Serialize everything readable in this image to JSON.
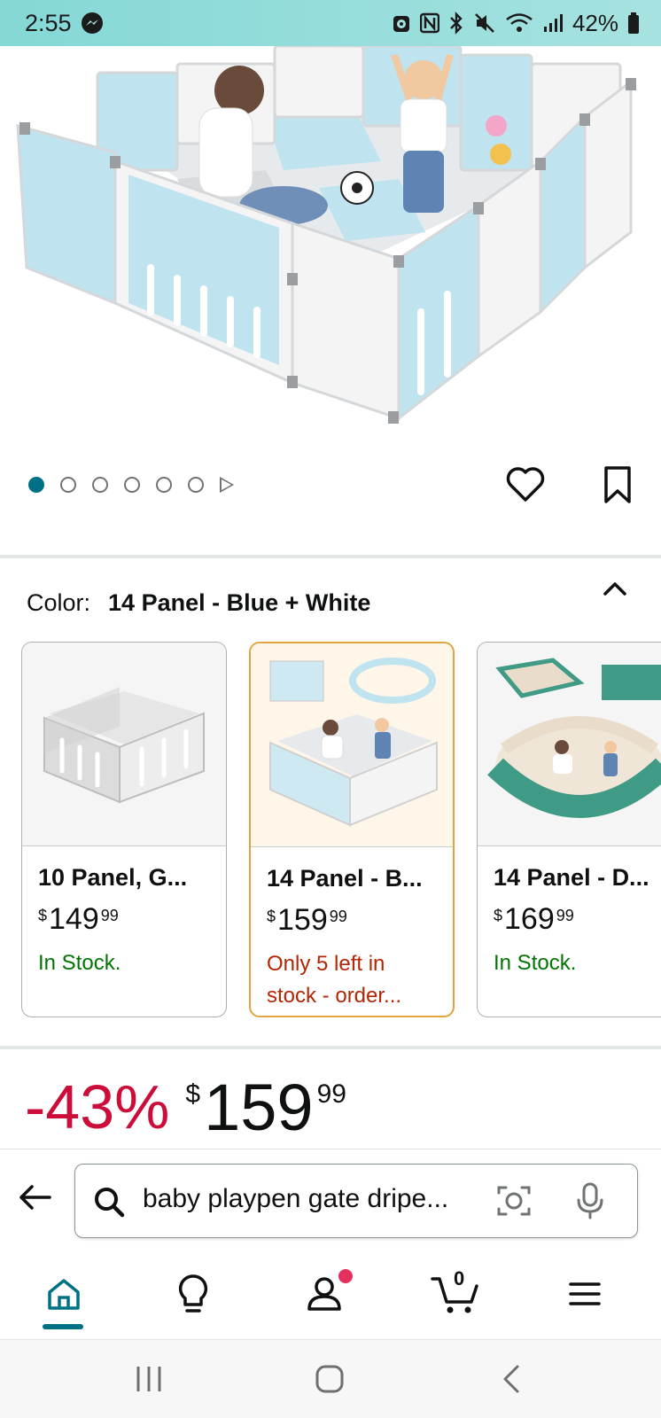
{
  "status_bar": {
    "time": "2:55",
    "battery": "42%"
  },
  "carousel": {
    "dot_count": 6,
    "active_index": 0
  },
  "color_section": {
    "label": "Color:",
    "value": "14 Panel - Blue + White"
  },
  "variants": [
    {
      "title": "10 Panel, G...",
      "currency": "$",
      "price_whole": "149",
      "price_fraction": "99",
      "stock_line1": "In Stock.",
      "stock_line2": "",
      "stock_color": "#007600",
      "selected": false
    },
    {
      "title": "14 Panel - B...",
      "currency": "$",
      "price_whole": "159",
      "price_fraction": "99",
      "stock_line1": "Only 5 left in",
      "stock_line2": "stock - order...",
      "stock_color": "#b12704",
      "selected": true
    },
    {
      "title": "14 Panel - D...",
      "currency": "$",
      "price_whole": "169",
      "price_fraction": "99",
      "stock_line1": "In Stock.",
      "stock_line2": "",
      "stock_color": "#007600",
      "selected": false
    }
  ],
  "price": {
    "discount": "-43%",
    "currency": "$",
    "whole": "159",
    "fraction": "99"
  },
  "search": {
    "query": "baby playpen gate dripe..."
  },
  "bottom_nav": {
    "cart_count": "0",
    "items": [
      "home-icon",
      "lightbulb-icon",
      "account-icon",
      "cart-icon",
      "menu-icon"
    ],
    "active": "home"
  },
  "colors": {
    "accent": "#007185",
    "discount_red": "#cc0c39",
    "in_stock_green": "#007600",
    "low_stock_red": "#b12704",
    "selected_border": "#e3a33e",
    "status_bar": "#84d8d6"
  }
}
